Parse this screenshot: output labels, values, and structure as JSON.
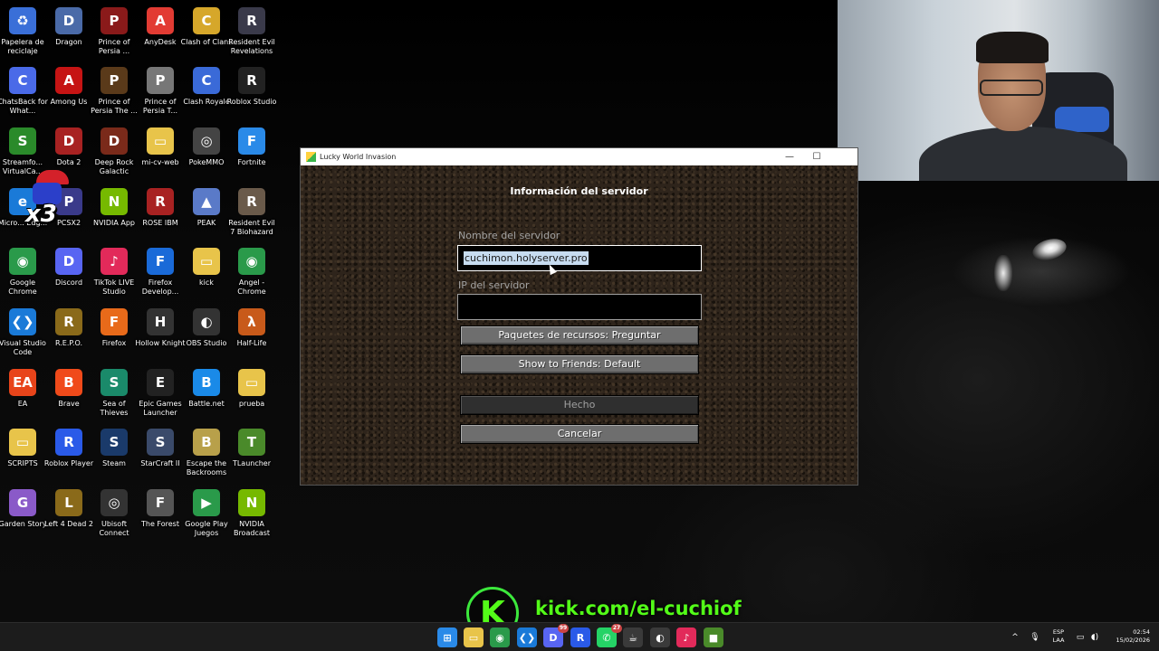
{
  "desktop": {
    "icons": [
      {
        "label": "Papelera de reciclaje",
        "icon": "recycle-bin-icon",
        "color": "#3a6fd8",
        "glyph": "♻"
      },
      {
        "label": "Dragon",
        "icon": "dragon-icon",
        "color": "#4a6aa8",
        "glyph": "D"
      },
      {
        "label": "Prince of Persia ...",
        "icon": "prince-of-persia-icon",
        "color": "#8a1a1a",
        "glyph": "P"
      },
      {
        "label": "AnyDesk",
        "icon": "anydesk-icon",
        "color": "#e23b33",
        "glyph": "A"
      },
      {
        "label": "Clash of Clans",
        "icon": "clash-of-clans-icon",
        "color": "#d6a72a",
        "glyph": "C"
      },
      {
        "label": "Resident Evil Revelations",
        "icon": "resident-evil-icon",
        "color": "#3a3a4a",
        "glyph": "R"
      },
      {
        "label": "ChatsBack for What...",
        "icon": "chatsback-icon",
        "color": "#4a6ae8",
        "glyph": "C"
      },
      {
        "label": "Among Us",
        "icon": "among-us-icon",
        "color": "#c61414",
        "glyph": "A"
      },
      {
        "label": "Prince of Persia The ...",
        "icon": "prince-of-persia-icon",
        "color": "#5a3a1a",
        "glyph": "P"
      },
      {
        "label": "Prince of Persia T...",
        "icon": "prince-of-persia-icon",
        "color": "#777777",
        "glyph": "P"
      },
      {
        "label": "Clash Royale",
        "icon": "clash-royale-icon",
        "color": "#3a6ad8",
        "glyph": "C"
      },
      {
        "label": "Roblox Studio",
        "icon": "roblox-studio-icon",
        "color": "#222222",
        "glyph": "R"
      },
      {
        "label": "Streamfo... VirtualCa...",
        "icon": "streamfog-icon",
        "color": "#2a8a2a",
        "glyph": "S"
      },
      {
        "label": "Dota 2",
        "icon": "dota2-icon",
        "color": "#a82222",
        "glyph": "D"
      },
      {
        "label": "Deep Rock Galactic",
        "icon": "deep-rock-galactic-icon",
        "color": "#7a2a1a",
        "glyph": "D"
      },
      {
        "label": "mi-cv-web",
        "icon": "folder-icon",
        "color": "#e8c44a",
        "glyph": "▭"
      },
      {
        "label": "PokeMMO",
        "icon": "pokemmo-icon",
        "color": "#444444",
        "glyph": "◎"
      },
      {
        "label": "Fortnite",
        "icon": "fortnite-icon",
        "color": "#2a8ae8",
        "glyph": "F"
      },
      {
        "label": "Micro... Edg...",
        "icon": "edge-icon",
        "color": "#1a7ad8",
        "glyph": "e"
      },
      {
        "label": "PCSX2",
        "icon": "pcsx2-icon",
        "color": "#3a3a8a",
        "glyph": "P"
      },
      {
        "label": "NVIDIA App",
        "icon": "nvidia-icon",
        "color": "#76b900",
        "glyph": "N"
      },
      {
        "label": "ROSE IBM",
        "icon": "rose-icon",
        "color": "#a82222",
        "glyph": "R"
      },
      {
        "label": "PEAK",
        "icon": "peak-icon",
        "color": "#5a7ac8",
        "glyph": "▲"
      },
      {
        "label": "Resident Evil 7 Biohazard",
        "icon": "resident-evil-icon",
        "color": "#6a5a4a",
        "glyph": "R"
      },
      {
        "label": "Google Chrome",
        "icon": "chrome-icon",
        "color": "#2a9a4a",
        "glyph": "◉"
      },
      {
        "label": "Discord",
        "icon": "discord-icon",
        "color": "#5865f2",
        "glyph": "D"
      },
      {
        "label": "TikTok LIVE Studio",
        "icon": "tiktok-icon",
        "color": "#e22a5a",
        "glyph": "♪"
      },
      {
        "label": "Firefox Develop...",
        "icon": "firefox-icon",
        "color": "#1a6ad8",
        "glyph": "F"
      },
      {
        "label": "kick",
        "icon": "folder-icon",
        "color": "#e8c44a",
        "glyph": "▭"
      },
      {
        "label": "Angel - Chrome",
        "icon": "chrome-icon",
        "color": "#2a9a4a",
        "glyph": "◉"
      },
      {
        "label": "Visual Studio Code",
        "icon": "vscode-icon",
        "color": "#1a7ad8",
        "glyph": "❮❯"
      },
      {
        "label": "R.E.P.O.",
        "icon": "repo-icon",
        "color": "#8a6a1a",
        "glyph": "R"
      },
      {
        "label": "Firefox",
        "icon": "firefox-icon",
        "color": "#e86a1a",
        "glyph": "F"
      },
      {
        "label": "Hollow Knight",
        "icon": "hollow-knight-icon",
        "color": "#333333",
        "glyph": "H"
      },
      {
        "label": "OBS Studio",
        "icon": "obs-icon",
        "color": "#333333",
        "glyph": "◐"
      },
      {
        "label": "Half-Life",
        "icon": "half-life-icon",
        "color": "#c85a1a",
        "glyph": "λ"
      },
      {
        "label": "EA",
        "icon": "ea-icon",
        "color": "#e8441a",
        "glyph": "EA"
      },
      {
        "label": "Brave",
        "icon": "brave-icon",
        "color": "#f04a1a",
        "glyph": "B"
      },
      {
        "label": "Sea of Thieves",
        "icon": "sea-of-thieves-icon",
        "color": "#1a8a6a",
        "glyph": "S"
      },
      {
        "label": "Epic Games Launcher",
        "icon": "epic-games-icon",
        "color": "#222222",
        "glyph": "E"
      },
      {
        "label": "Battle.net",
        "icon": "battlenet-icon",
        "color": "#1a8ae8",
        "glyph": "B"
      },
      {
        "label": "prueba",
        "icon": "folder-icon",
        "color": "#e8c44a",
        "glyph": "▭"
      },
      {
        "label": "SCRIPTS",
        "icon": "folder-icon",
        "color": "#e8c44a",
        "glyph": "▭"
      },
      {
        "label": "Roblox Player",
        "icon": "roblox-player-icon",
        "color": "#2a5ae8",
        "glyph": "R"
      },
      {
        "label": "Steam",
        "icon": "steam-icon",
        "color": "#1a3a6a",
        "glyph": "S"
      },
      {
        "label": "StarCraft II",
        "icon": "starcraft-icon",
        "color": "#3a4a6a",
        "glyph": "S"
      },
      {
        "label": "Escape the Backrooms",
        "icon": "backrooms-icon",
        "color": "#b8a04a",
        "glyph": "B"
      },
      {
        "label": "TLauncher",
        "icon": "tlauncher-icon",
        "color": "#4a8a2a",
        "glyph": "T"
      },
      {
        "label": "Garden Story",
        "icon": "garden-story-icon",
        "color": "#8a5ac8",
        "glyph": "G"
      },
      {
        "label": "Left 4 Dead 2",
        "icon": "left4dead-icon",
        "color": "#8a6a1a",
        "glyph": "L"
      },
      {
        "label": "Ubisoft Connect",
        "icon": "ubisoft-icon",
        "color": "#333333",
        "glyph": "◎"
      },
      {
        "label": "The Forest",
        "icon": "the-forest-icon",
        "color": "#555555",
        "glyph": "F"
      },
      {
        "label": "Google Play Juegos",
        "icon": "google-play-games-icon",
        "color": "#2a9a4a",
        "glyph": "▶"
      },
      {
        "label": "NVIDIA Broadcast",
        "icon": "nvidia-broadcast-icon",
        "color": "#76b900",
        "glyph": "N"
      }
    ]
  },
  "window": {
    "title": "Lucky World Invasion",
    "minimize": "—",
    "maximize": "☐",
    "heading": "Información del servidor",
    "server_name_label": "Nombre del servidor",
    "server_name_value": "cuchimon.holyserver.pro",
    "server_ip_label": "IP del servidor",
    "server_ip_value": "",
    "resource_packs_button": "Paquetes de recursos: Preguntar",
    "show_friends_button": "Show to Friends: Default",
    "done_button": "Hecho",
    "cancel_button": "Cancelar"
  },
  "overlay": {
    "kick_logo": "K",
    "kick_text": "kick.com/el-cuchiof",
    "accent": "#53fc18"
  },
  "taskbar": {
    "apps": [
      {
        "name": "start-button",
        "glyph": "⊞",
        "color": "#2a8ae8",
        "badge": ""
      },
      {
        "name": "file-explorer",
        "glyph": "▭",
        "color": "#e8c44a",
        "badge": ""
      },
      {
        "name": "chrome",
        "glyph": "◉",
        "color": "#2a9a4a",
        "badge": ""
      },
      {
        "name": "vscode",
        "glyph": "❮❯",
        "color": "#1a7ad8",
        "badge": ""
      },
      {
        "name": "discord",
        "glyph": "D",
        "color": "#5865f2",
        "badge": "99"
      },
      {
        "name": "roblox-studio",
        "glyph": "R",
        "color": "#2a5ae8",
        "badge": ""
      },
      {
        "name": "whatsapp",
        "glyph": "✆",
        "color": "#25d366",
        "badge": "27"
      },
      {
        "name": "java",
        "glyph": "☕",
        "color": "#3a3a3a",
        "badge": ""
      },
      {
        "name": "obs",
        "glyph": "◐",
        "color": "#3a3a3a",
        "badge": ""
      },
      {
        "name": "tiktok",
        "glyph": "♪",
        "color": "#e22a5a",
        "badge": ""
      },
      {
        "name": "minecraft",
        "glyph": "■",
        "color": "#4a8a2a",
        "badge": ""
      }
    ],
    "tray": {
      "chevron": "^",
      "mic": "🎙",
      "lang_line1": "ESP",
      "lang_line2": "LAA",
      "time": "02:54",
      "date": "15/02/2026"
    }
  }
}
